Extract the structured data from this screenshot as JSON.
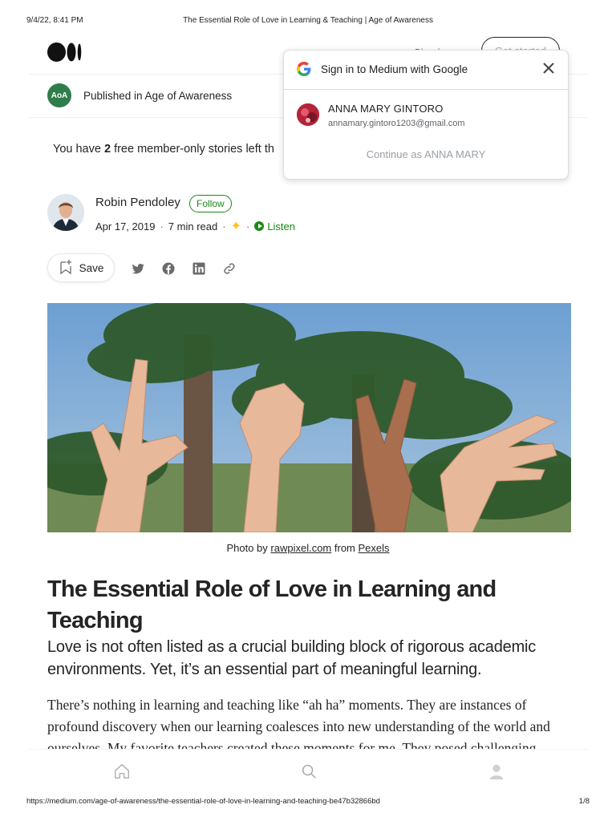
{
  "print_header": {
    "datetime": "9/4/22, 8:41 PM",
    "title": "The Essential Role of Love in Learning & Teaching | Age of Awareness"
  },
  "print_footer": {
    "url": "https://medium.com/age-of-awareness/the-essential-role-of-love-in-learning-and-teaching-be47b32866bd",
    "page": "1/8"
  },
  "topbar": {
    "signin_label": "Sign in",
    "get_started_label": "Get started"
  },
  "publication": {
    "logo_text": "AoA",
    "published_label": "Published in Age of Awareness"
  },
  "member_notice": {
    "prefix": "You have ",
    "count": "2",
    "suffix": " free member-only stories left th"
  },
  "author": {
    "name": "Robin Pendoley",
    "follow_label": "Follow",
    "date": "Apr 17, 2019",
    "read_time": "7 min read",
    "listen_label": "Listen"
  },
  "actions": {
    "save_label": "Save",
    "share_icons": [
      "twitter-icon",
      "facebook-icon",
      "linkedin-icon",
      "link-icon"
    ]
  },
  "hero": {
    "caption_prefix": "Photo by ",
    "caption_credit": "rawpixel.com",
    "caption_middle": " from ",
    "caption_source": "Pexels"
  },
  "article": {
    "title": "The Essential Role of Love in Learning and Teaching",
    "subtitle": "Love is not often listed as a crucial building block of rigorous academic environments. Yet, it’s an essential part of meaningful learning.",
    "body": "There’s nothing in learning and teaching like “ah ha” moments. They are instances of profound discovery when our learning coalesces into new understanding of the world and ourselves. My favorite teachers created these moments for me. They posed challenging"
  },
  "bottom_nav": {
    "items": [
      "home-icon",
      "search-icon",
      "profile-icon"
    ]
  },
  "google_signin": {
    "title": "Sign in to Medium with Google",
    "account_name": "ANNA MARY GINTORO",
    "account_email": "annamary.gintoro1203@gmail.com",
    "continue_label": "Continue as ANNA MARY"
  },
  "colors": {
    "accent_green": "#1a8917",
    "text": "#242424",
    "star": "#ffc017"
  }
}
